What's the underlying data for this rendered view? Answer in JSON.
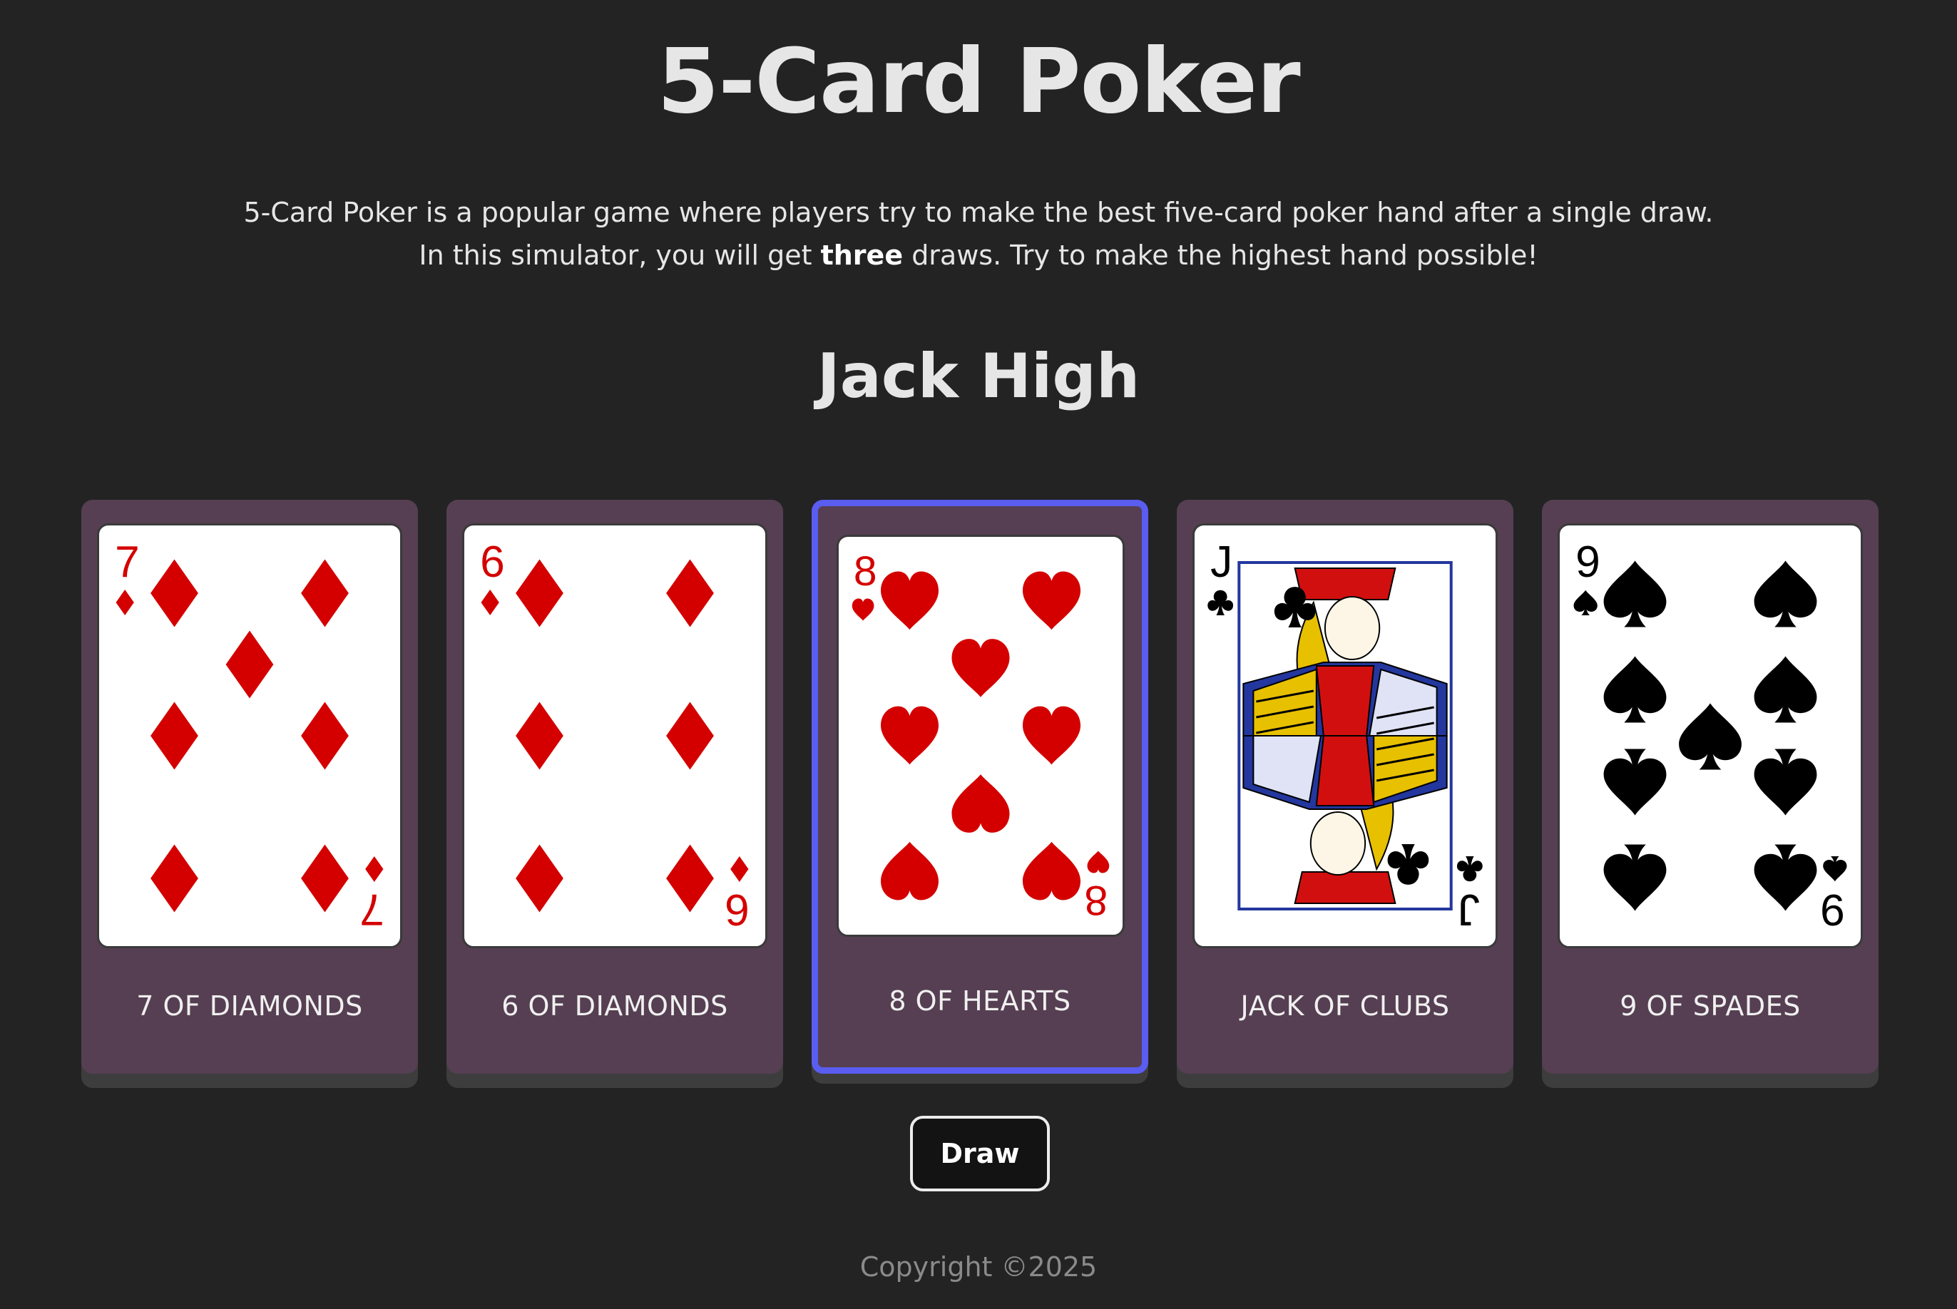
{
  "header": {
    "title": "5-Card Poker",
    "intro_line1": "5-Card Poker is a popular game where players try to make the best five-card poker hand after a single draw.",
    "intro_line2_before": "In this simulator, you will get ",
    "intro_line2_bold": "three",
    "intro_line2_after": " draws. Try to make the highest hand possible!"
  },
  "hand": {
    "result": "Jack High"
  },
  "cards": [
    {
      "label": "7 OF DIAMONDS",
      "rank": "7",
      "suit": "diamonds",
      "selected": false
    },
    {
      "label": "6 OF DIAMONDS",
      "rank": "6",
      "suit": "diamonds",
      "selected": false
    },
    {
      "label": "8 OF HEARTS",
      "rank": "8",
      "suit": "hearts",
      "selected": true
    },
    {
      "label": "JACK OF CLUBS",
      "rank": "J",
      "suit": "clubs",
      "selected": false
    },
    {
      "label": "9 OF SPADES",
      "rank": "9",
      "suit": "spades",
      "selected": false
    }
  ],
  "controls": {
    "draw_label": "Draw"
  },
  "footer": {
    "copyright": "Copyright ©2025"
  },
  "colors": {
    "background": "#232323",
    "card_slot": "#563f52",
    "selected_border": "#5a5df0",
    "red_suit": "#d40000",
    "black_suit": "#000000"
  }
}
